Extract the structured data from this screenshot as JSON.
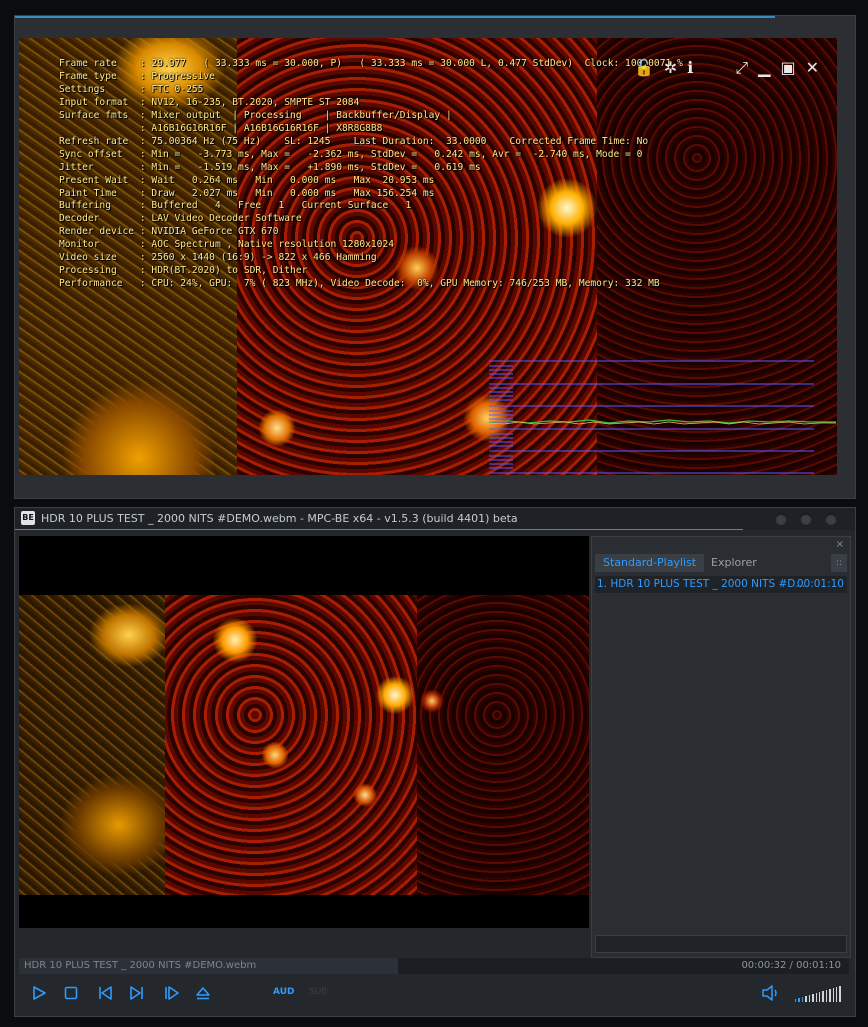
{
  "colors": {
    "accent": "#2f9bff",
    "osd_text": "#ffe98a",
    "graph_sync": "#5a5aff",
    "graph_green": "#40c040"
  },
  "fullscreen_window": {
    "osd_lines": [
      "Frame rate    : 29.977   ( 33.333 ms = 30.000, P)   ( 33.333 ms = 30.000 L, 0.477 StdDev)  Clock: 100.0071 %",
      "Frame type    : Progressive",
      "Settings      : FTC 0-255",
      "Input format  : NV12, 16-235, BT.2020, SMPTE ST 2084",
      "Surface fmts  : Mixer output  | Processing    | Backbuffer/Display |",
      "              : A16B16G16R16F | A16B16G16R16F | X8R8G8B8",
      "Refresh rate  : 75.00364 Hz (75 Hz)    SL: 1245    Last Duration:  33.0000    Corrected Frame Time: No",
      "Sync offset   : Min =   -3.773 ms, Max =   -2.362 ms, StdDev =   0.242 ms, Avr =  -2.740 ms, Mode = 0",
      "Jitter        : Min =   -1.519 ms, Max =   +1.890 ms, StdDev =   0.619 ms",
      "Present Wait  : Wait   0.264 ms   Min   0.000 ms   Max  20.953 ms",
      "Paint Time    : Draw   2.027 ms   Min   0.000 ms   Max 156.254 ms",
      "Buffering     : Buffered   4   Free   1   Current Surface   1",
      "Decoder       : LAV Video Decoder Software",
      "Render device : NVIDIA GeForce GTX 670",
      "Monitor       : AOC Spectrum , Native resolution 1280x1024",
      "Video size    : 2560 x 1440 (16:9) -> 822 x 466 Hamming",
      "Processing    : HDR(BT.2020) to SDR, Dither",
      "Performance   : CPU: 24%, GPU:  7% ( 823 MHz), Video Decode:  0%, GPU Memory: 746/253 MB, Memory: 332 MB"
    ],
    "controls": [
      "lock-icon",
      "gear-icon",
      "info-icon",
      "fullscreen-icon",
      "minimize-icon",
      "maximize-icon",
      "close-icon"
    ]
  },
  "main_window": {
    "title": "HDR 10 PLUS TEST _ 2000 NITS #DEMO.webm - MPC-BE x64 - v1.5.3 (build 4401) beta",
    "app_icon_text": "BE",
    "playlist": {
      "close_glyph": "×",
      "tabs": [
        "Standard-Playlist",
        "Explorer"
      ],
      "grip": "::",
      "items": [
        {
          "label": "1. HDR 10 PLUS TEST _ 2000 NITS #D...",
          "duration": "00:01:10"
        }
      ]
    },
    "seekbar": {
      "filename": "HDR 10 PLUS TEST _ 2000 NITS #DEMO.webm",
      "time": "00:00:32 / 00:01:10",
      "position_fraction": 0.457
    },
    "toolbar": {
      "aud_label": "AUD",
      "sub_label": "SUB",
      "volume_fraction": 0.15,
      "buttons": [
        "play-icon",
        "stop-icon",
        "prev-icon",
        "next-icon",
        "frame-step-icon",
        "eject-icon"
      ]
    }
  }
}
